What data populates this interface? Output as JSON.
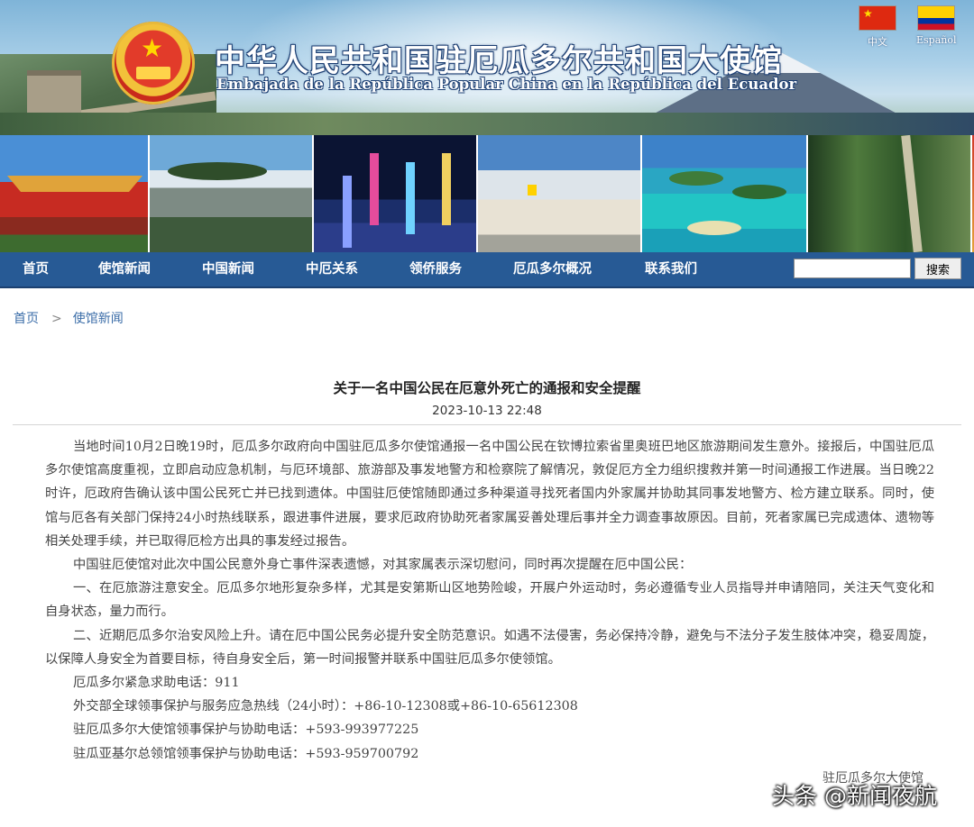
{
  "header": {
    "title_cn": "中华人民共和国驻厄瓜多尔共和国大使馆",
    "title_es": "Embajada de la República Popular China en la República del Ecuador",
    "languages": [
      {
        "label": "中文",
        "flag": "china-flag-icon"
      },
      {
        "label": "Español",
        "flag": "ecuador-flag-icon"
      }
    ]
  },
  "nav": {
    "items": [
      "首页",
      "使馆新闻",
      "中国新闻",
      "中厄关系",
      "领侨服务",
      "厄瓜多尔概况",
      "联系我们"
    ],
    "search_placeholder": "",
    "search_button": "搜索"
  },
  "breadcrumb": {
    "home": "首页",
    "separator": ">",
    "current": "使馆新闻"
  },
  "article": {
    "title": "关于一名中国公民在厄意外死亡的通报和安全提醒",
    "date": "2023-10-13 22:48",
    "paragraphs": [
      "当地时间10月2日晚19时，厄瓜多尔政府向中国驻厄瓜多尔使馆通报一名中国公民在钦博拉索省里奥班巴地区旅游期间发生意外。接报后，中国驻厄瓜多尔使馆高度重视，立即启动应急机制，与厄环境部、旅游部及事发地警方和检察院了解情况，敦促厄方全力组织搜救并第一时间通报工作进展。当日晚22时许，厄政府告确认该中国公民死亡并已找到遗体。中国驻厄使馆随即通过多种渠道寻找死者国内外家属并协助其同事发地警方、检方建立联系。同时，使馆与厄各有关部门保持24小时热线联系，跟进事件进展，要求厄政府协助死者家属妥善处理后事并全力调查事故原因。目前，死者家属已完成遗体、遗物等相关处理手续，并已取得厄检方出具的事发经过报告。",
      "中国驻厄使馆对此次中国公民意外身亡事件深表遗憾，对其家属表示深切慰问，同时再次提醒在厄中国公民：",
      "一、在厄旅游注意安全。厄瓜多尔地形复杂多样，尤其是安第斯山区地势险峻，开展户外运动时，务必遵循专业人员指导并申请陪同，关注天气变化和自身状态，量力而行。",
      "二、近期厄瓜多尔治安风险上升。请在厄中国公民务必提升安全防范意识。如遇不法侵害，务必保持冷静，避免与不法分子发生肢体冲突，稳妥周旋，以保障人身安全为首要目标，待自身安全后，第一时间报警并联系中国驻厄瓜多尔使领馆。"
    ],
    "contacts": [
      "厄瓜多尔紧急求助电话：911",
      "外交部全球领事保护与服务应急热线（24小时）：+86-10-12308或+86-10-65612308",
      "驻厄瓜多尔大使馆领事保护与协助电话：+593-993977225",
      "驻瓜亚基尔总领馆领事保护与协助电话：+593-959700792"
    ],
    "signature": "驻厄瓜多尔大使馆"
  },
  "watermark": "头条 @新闻夜航"
}
